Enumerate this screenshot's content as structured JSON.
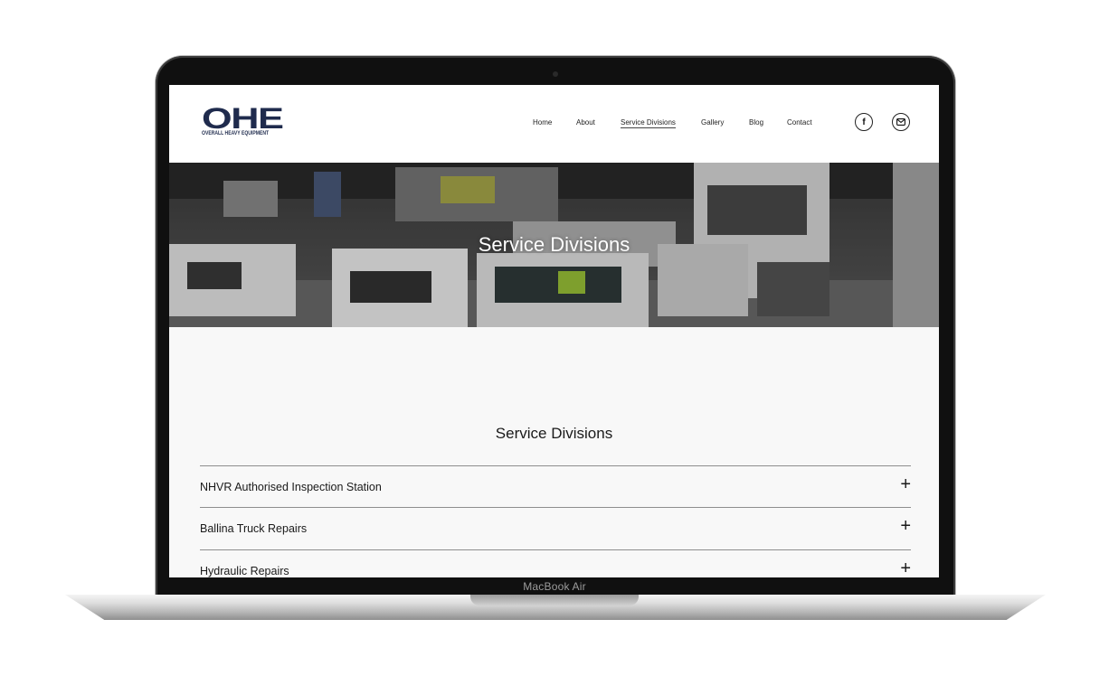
{
  "device": {
    "model_label": "MacBook Air"
  },
  "header": {
    "logo_text": "OHE",
    "logo_subtext": "OVERALL HEAVY EQUIPMENT",
    "nav": [
      {
        "label": "Home"
      },
      {
        "label": "About"
      },
      {
        "label": "Service Divisions",
        "active": true
      },
      {
        "label": "Gallery"
      },
      {
        "label": "Blog"
      },
      {
        "label": "Contact"
      }
    ],
    "social_icons": [
      "facebook-icon",
      "email-icon"
    ]
  },
  "hero": {
    "title": "Service Divisions"
  },
  "main": {
    "section_title": "Service Divisions",
    "accordion": [
      {
        "label": "NHVR Authorised Inspection Station",
        "icon": "plus-icon"
      },
      {
        "label": "Ballina Truck Repairs",
        "icon": "plus-icon"
      },
      {
        "label": "Hydraulic Repairs",
        "icon": "plus-icon"
      }
    ]
  },
  "colors": {
    "brand": "#1f2b4d",
    "text": "#1a1a1a",
    "page_bg": "#f8f8f8"
  }
}
